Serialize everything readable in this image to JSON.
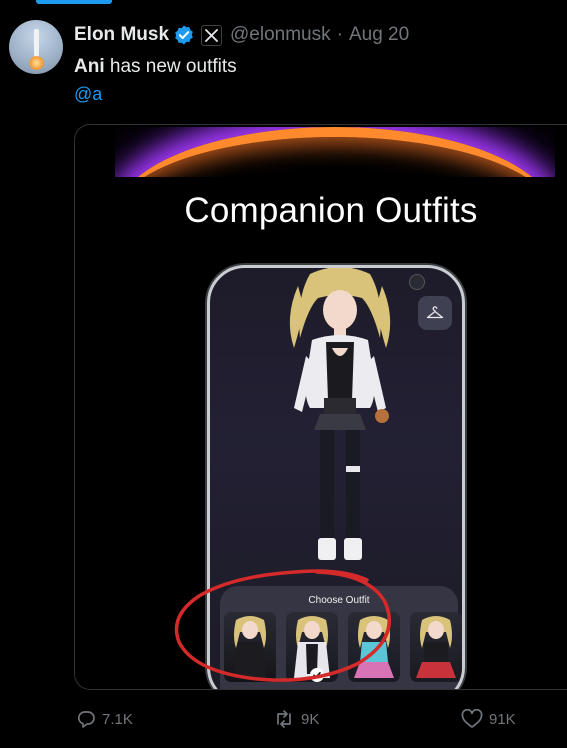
{
  "tweet": {
    "author_name": "Elon Musk",
    "handle": "@elonmusk",
    "separator": "·",
    "date": "Aug 20",
    "text_bold": "Ani",
    "text_rest": " has new outfits",
    "mention": "@a"
  },
  "media": {
    "title": "Companion Outfits",
    "sheet_title": "Choose Outfit"
  },
  "actions": {
    "replies": "7.1K",
    "retweets": "9K",
    "likes": "91K"
  },
  "colors": {
    "accent": "#1d9bf0",
    "muted": "#71767b",
    "annotation_circle": "#d42a2a"
  }
}
